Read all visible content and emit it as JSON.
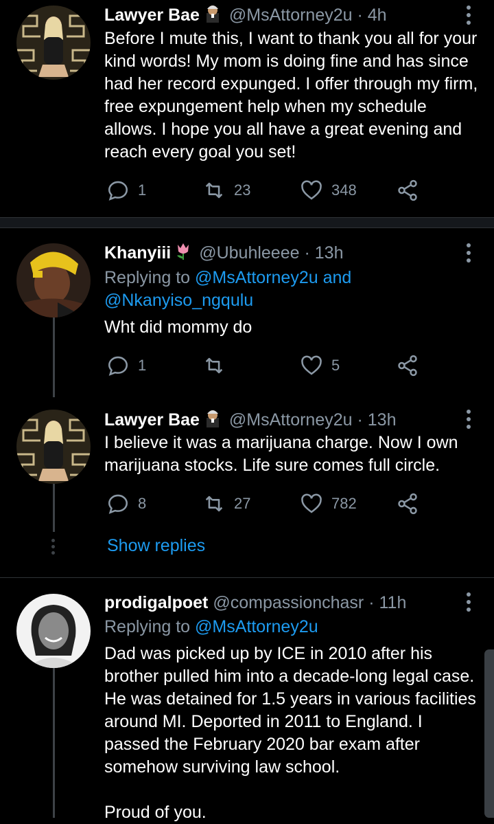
{
  "tweets": [
    {
      "name": "Lawyer Bae",
      "handle": "@MsAttorney2u",
      "time": "· 4h",
      "text": "Before I mute this, I want to thank you all for your kind words! My mom is doing fine and has since had her record expunged. I offer through my firm, free expungement help when my schedule allows. I hope you all have a great evening and reach every goal you set!",
      "replies": "1",
      "retweets": "23",
      "likes": "348"
    },
    {
      "name": "Khanyiii",
      "handle": "@Ubuhleeee",
      "time": "· 13h",
      "replying_prefix": "Replying to",
      "mention1": "@MsAttorney2u",
      "and": "and",
      "mention2": "@Nkanyiso_ngqulu",
      "text": "Wht did mommy do",
      "replies": "1",
      "retweets": "",
      "likes": "5"
    },
    {
      "name": "Lawyer Bae",
      "handle": "@MsAttorney2u",
      "time": "· 13h",
      "text": "I believe it was a marijuana charge. Now I own marijuana stocks. Life sure comes full circle.",
      "replies": "8",
      "retweets": "27",
      "likes": "782"
    },
    {
      "name": "prodigalpoet",
      "handle": "@compassionchasr",
      "time": "· 11h",
      "replying_prefix": "Replying to",
      "mention1": "@MsAttorney2u",
      "text": "Dad was picked up by ICE in 2010 after his brother pulled him into a decade-long legal case. He was detained for 1.5 years in various facilities around MI. Deported in 2011 to England. I passed the February 2020 bar exam after somehow surviving law school.",
      "text2": "Proud of you."
    }
  ],
  "show_replies": "Show replies",
  "icons": {
    "reply": "reply-icon",
    "retweet": "retweet-icon",
    "like": "heart-icon",
    "share": "share-icon",
    "more": "more-vertical-icon",
    "judge_emoji": "judge-emoji-icon",
    "tulip_emoji": "tulip-emoji-icon"
  },
  "colors": {
    "accent": "#1d9bf0",
    "muted": "#8b98a5",
    "background": "#000000"
  }
}
